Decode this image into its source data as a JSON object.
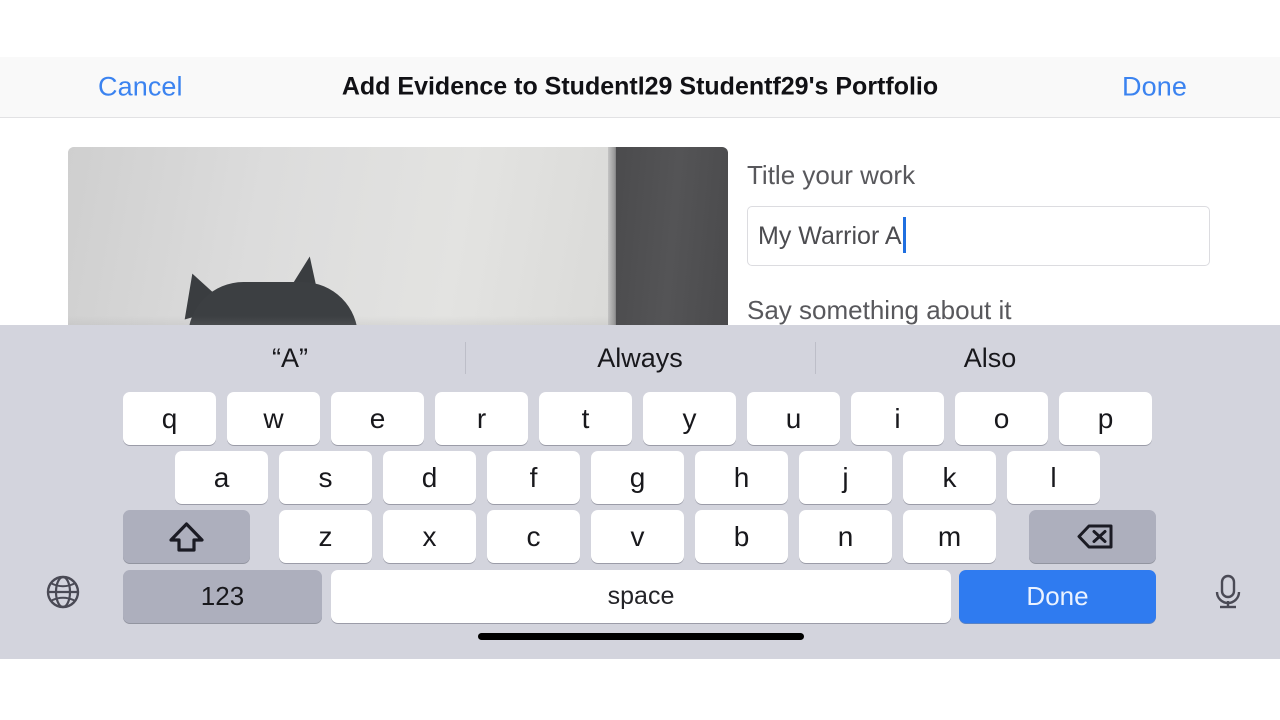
{
  "navbar": {
    "cancel_label": "Cancel",
    "title": "Add Evidence to Studentl29 Studentf29's Portfolio",
    "done_label": "Done",
    "link_color": "#3b83f0"
  },
  "media": {
    "alt": "photo of a dark cat's head against a light gray wall"
  },
  "form": {
    "title_label": "Title your work",
    "title_value": "My Warrior A",
    "title_placeholder": "",
    "description_label": "Say something about it"
  },
  "keyboard": {
    "suggestions": [
      "“A”",
      "Always",
      "Also"
    ],
    "row1": [
      "q",
      "w",
      "e",
      "r",
      "t",
      "y",
      "u",
      "i",
      "o",
      "p"
    ],
    "row2": [
      "a",
      "s",
      "d",
      "f",
      "g",
      "h",
      "j",
      "k",
      "l"
    ],
    "row3": [
      "z",
      "x",
      "c",
      "v",
      "b",
      "n",
      "m"
    ],
    "shift_icon": "shift-arrow-icon",
    "backspace_icon": "backspace-icon",
    "numbers_label": "123",
    "space_label": "space",
    "return_label": "Done",
    "globe_icon": "globe-icon",
    "mic_icon": "microphone-icon",
    "background_color": "#d3d4dd",
    "return_key_color": "#2f7bf0"
  }
}
